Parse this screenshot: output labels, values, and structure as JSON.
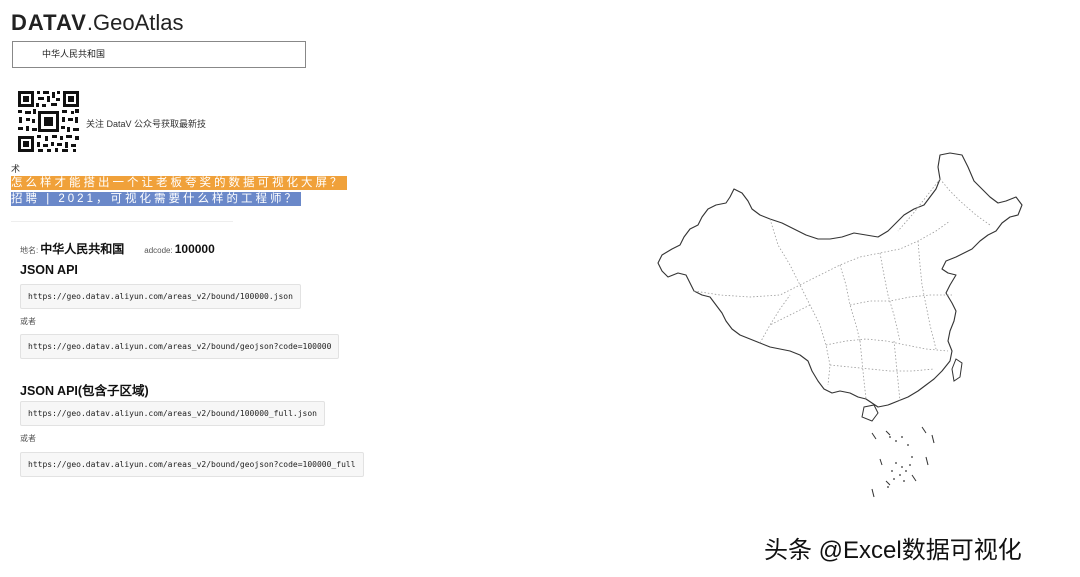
{
  "header": {
    "brand": "DATAV",
    "product": ".GeoAtlas"
  },
  "region_select": {
    "value": "中华人民共和国"
  },
  "promo": {
    "follow_text": "关注 DataV 公众号获取最新技",
    "follow_text_wrap": "术",
    "ad_links": [
      {
        "text": "怎么样才能搭出一个让老板夸奖的数据可视化大屏？",
        "color": "#f0a13a"
      },
      {
        "text": "招聘 | 2021，可视化需要什么样的工程师？",
        "color": "#6a88c9"
      }
    ]
  },
  "info": {
    "name_label": "地名:",
    "name_value": "中华人民共和国",
    "adcode_label": "adcode:",
    "adcode_value": "100000"
  },
  "api": {
    "title": "JSON API",
    "url_1": "https://geo.datav.aliyun.com/areas_v2/bound/100000.json",
    "or": "或者",
    "url_2": "https://geo.datav.aliyun.com/areas_v2/bound/geojson?code=100000"
  },
  "api_full": {
    "title": "JSON API(包含子区域)",
    "url_1": "https://geo.datav.aliyun.com/areas_v2/bound/100000_full.json",
    "or": "或者",
    "url_2": "https://geo.datav.aliyun.com/areas_v2/bound/geojson?code=100000_full"
  },
  "icons": {
    "qr": "qr-code-icon",
    "map": "china-map"
  },
  "watermark": "头条 @Excel数据可视化"
}
